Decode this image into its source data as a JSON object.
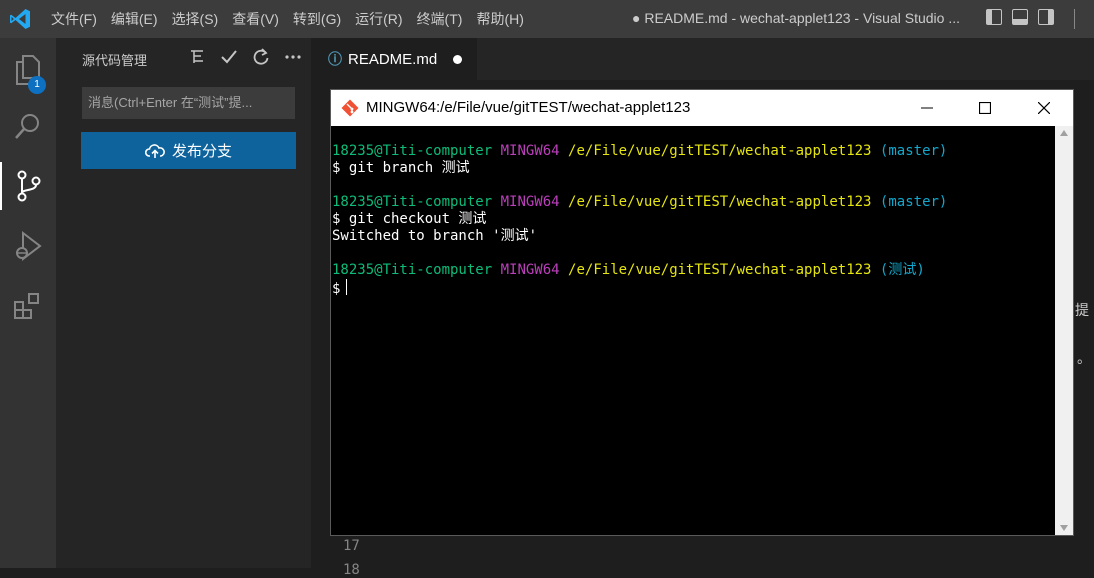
{
  "titlebar": {
    "menu": [
      "文件(F)",
      "编辑(E)",
      "选择(S)",
      "查看(V)",
      "转到(G)",
      "运行(R)",
      "终端(T)",
      "帮助(H)"
    ],
    "window_title": "● README.md - wechat-applet123 - Visual Studio ..."
  },
  "activity_bar": {
    "items": [
      "explorer-icon",
      "search-icon",
      "source-control-icon",
      "run-debug-icon",
      "extensions-icon"
    ],
    "explorer_badge": "1"
  },
  "sidebar": {
    "title": "源代码管理",
    "message_placeholder": "消息(Ctrl+Enter 在“测试”提...",
    "publish_button": "发布分支"
  },
  "editor": {
    "tab_label": "README.md",
    "tab_modified": true,
    "line_17": "17",
    "line_18": "18",
    "partial_char_1": "提",
    "partial_char_2": "。"
  },
  "terminal": {
    "title": "MINGW64:/e/File/vue/gitTEST/wechat-applet123",
    "user_host": "18235@Titi-computer",
    "env": "MINGW64",
    "path": "/e/File/vue/gitTEST/wechat-applet123",
    "branch_1": "(master)",
    "cmd_1": "$ git branch 测试",
    "branch_2": "(master)",
    "cmd_2": "$ git checkout 测试",
    "output_2": "Switched to branch '测试'",
    "branch_3": "(测试)",
    "prompt_3": "$"
  },
  "colors": {
    "accent_blue": "#0e639c",
    "terminal_green": "#0dbc79",
    "terminal_magenta": "#bc3fbc",
    "terminal_yellow": "#e5e510",
    "terminal_cyan": "#11a8cd"
  }
}
